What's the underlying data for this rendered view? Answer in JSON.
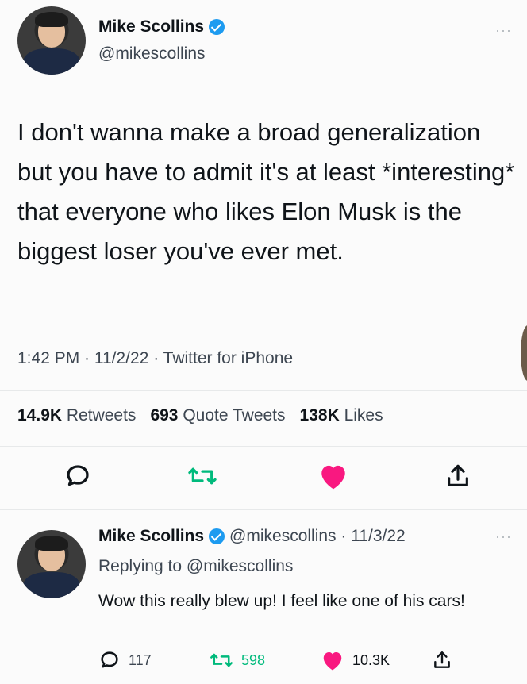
{
  "tweet": {
    "author_name": "Mike Scollins",
    "author_handle": "@mikescollins",
    "text": "I don't wanna make a broad generalization but you have to admit it's at least *interesting* that everyone who likes Elon Musk is the biggest loser you've ever met.",
    "meta": "1:42 PM · 11/2/22 · Twitter for iPhone",
    "stats": {
      "retweets_count": "14.9K",
      "retweets_label": "Retweets",
      "quotes_count": "693",
      "quotes_label": "Quote Tweets",
      "likes_count": "138K",
      "likes_label": "Likes"
    },
    "actions": {
      "reply_icon": "reply-icon",
      "retweet_icon": "retweet-icon",
      "like_icon": "heart-icon",
      "share_icon": "share-icon"
    },
    "more_label": "···"
  },
  "reply": {
    "author_name": "Mike Scollins",
    "author_handle_date": "@mikescollins · 11/3/22",
    "replying_prefix": "Replying to ",
    "replying_handle": "@mikescollins",
    "text": "Wow this really blew up! I feel like one of his cars!",
    "reply_count": "117",
    "retweet_count": "598",
    "like_count": "10.3K",
    "more_label": "···"
  },
  "colors": {
    "accent": "#1d9bf0",
    "retweet_green": "#00ba7c",
    "like_red": "#f91880",
    "text": "#0f1419",
    "secondary": "#3d4651"
  }
}
